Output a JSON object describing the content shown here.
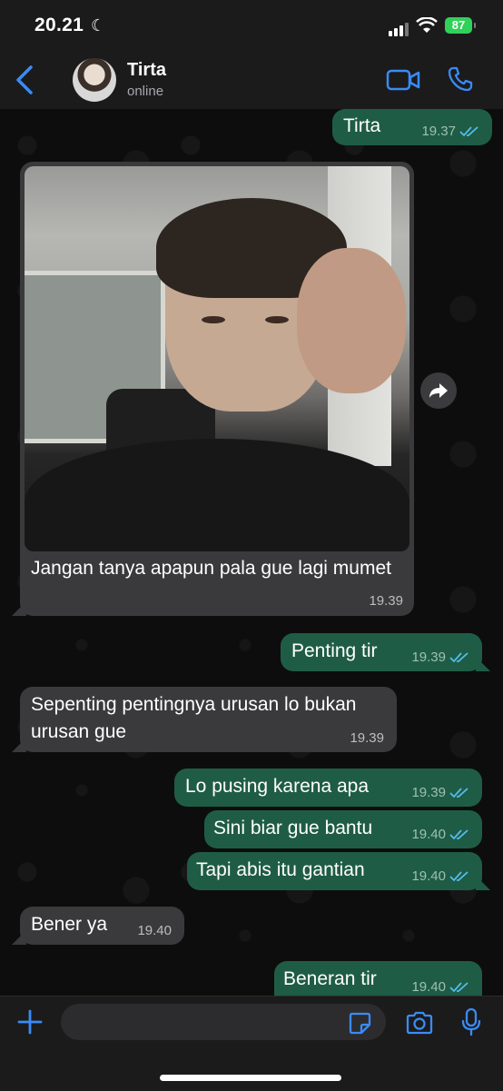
{
  "status_bar": {
    "time": "20.21",
    "battery": "87"
  },
  "header": {
    "contact_name": "Tirta",
    "presence": "online"
  },
  "messages": [
    {
      "direction": "out",
      "text": "Tirta",
      "time": "19.37",
      "read": true
    },
    {
      "direction": "in",
      "type": "image",
      "caption": "Jangan tanya apapun pala gue lagi mumet",
      "time": "19.39"
    },
    {
      "direction": "out",
      "text": "Penting tir",
      "time": "19.39",
      "read": true
    },
    {
      "direction": "in",
      "text": "Sepenting pentingnya urusan lo bukan urusan gue",
      "time": "19.39"
    },
    {
      "direction": "out",
      "text": "Lo pusing karena apa",
      "time": "19.39",
      "read": true
    },
    {
      "direction": "out",
      "text": "Sini biar gue bantu",
      "time": "19.40",
      "read": true
    },
    {
      "direction": "out",
      "text": "Tapi abis itu gantian",
      "time": "19.40",
      "read": true
    },
    {
      "direction": "in",
      "text": "Bener ya",
      "time": "19.40"
    },
    {
      "direction": "out",
      "text": "Beneran tir",
      "time": "19.40",
      "read": true
    }
  ],
  "colors": {
    "outgoing_bubble": "#1f5c46",
    "incoming_bubble": "#3a3a3c",
    "accent": "#3b8bf5",
    "read_tick": "#53bdeb"
  },
  "icons": {
    "back": "chevron-left-icon",
    "video": "video-camera-icon",
    "call": "phone-icon",
    "forward": "forward-arrow-icon",
    "attach": "plus-icon",
    "sticker": "sticker-icon",
    "camera": "camera-icon",
    "mic": "microphone-icon"
  }
}
